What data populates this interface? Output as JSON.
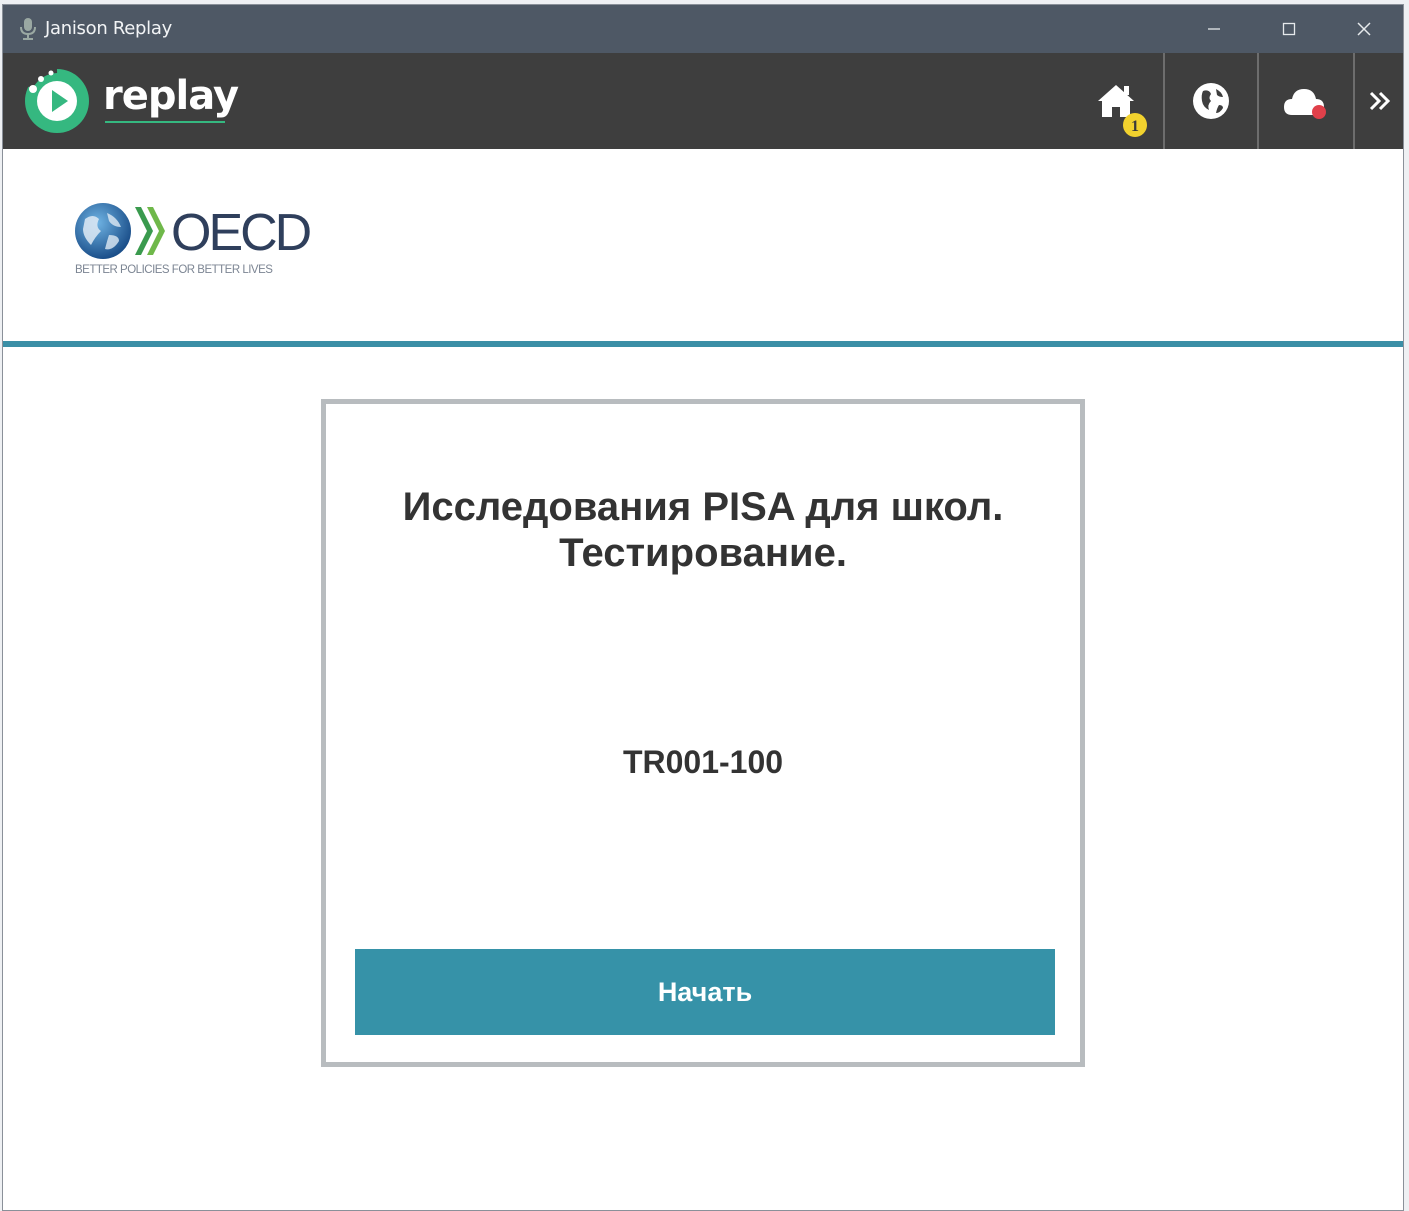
{
  "window": {
    "title": "Janison Replay",
    "controls": [
      "minimize-icon",
      "maximize-icon",
      "close-icon"
    ]
  },
  "appbar": {
    "brand": "replay",
    "nav": [
      {
        "name": "home",
        "icon": "home-icon",
        "badge": "1"
      },
      {
        "name": "globe",
        "icon": "globe-icon"
      },
      {
        "name": "cloud",
        "icon": "cloud-icon",
        "status_color": "#e0404a"
      },
      {
        "name": "more",
        "icon": "double-chevron-right-icon"
      }
    ]
  },
  "oecd": {
    "name": "OECD",
    "tagline": "BETTER POLICIES FOR BETTER LIVES"
  },
  "card": {
    "title_line1": "Исследования PISA для школ.",
    "title_line2": "Тестирование.",
    "code": "TR001-100",
    "start_button": "Начать"
  },
  "colors": {
    "titlebar": "#4e5865",
    "appbar": "#3e3e3e",
    "brand_accent": "#35b880",
    "teal": "#3692a8",
    "badge": "#f2d22e"
  }
}
